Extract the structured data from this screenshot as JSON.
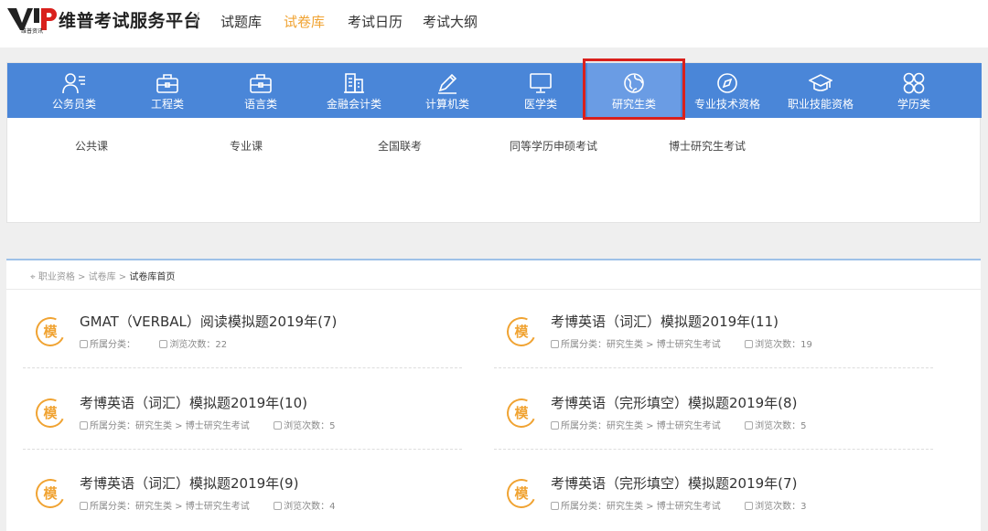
{
  "header": {
    "logo_text": "VIP",
    "logo_sub": "维普资讯",
    "brand": "维普考试服务平台",
    "slash": "/",
    "nav": [
      "试题库",
      "试卷库",
      "考试日历",
      "考试大纲"
    ],
    "active_nav": "试卷库",
    "colors": {
      "active": "#f0a332"
    }
  },
  "categories": {
    "items": [
      {
        "label": "公务员类",
        "icon": "person-list-icon"
      },
      {
        "label": "工程类",
        "icon": "briefcase-icon"
      },
      {
        "label": "语言类",
        "icon": "briefcase-icon"
      },
      {
        "label": "金融会计类",
        "icon": "building-icon"
      },
      {
        "label": "计算机类",
        "icon": "pencil-icon"
      },
      {
        "label": "医学类",
        "icon": "monitor-icon"
      },
      {
        "label": "研究生类",
        "icon": "globe-icon"
      },
      {
        "label": "专业技术资格",
        "icon": "compass-icon"
      },
      {
        "label": "职业技能资格",
        "icon": "graduation-cap-icon"
      },
      {
        "label": "学历类",
        "icon": "four-circles-icon"
      }
    ],
    "selected": "研究生类",
    "subcategories": [
      "公共课",
      "专业课",
      "全国联考",
      "同等学历申硕考试",
      "博士研究生考试"
    ],
    "colors": {
      "bar": "#4a86d8",
      "highlight": "#d9201c"
    }
  },
  "breadcrumb": {
    "items": [
      "职业资格",
      "试卷库",
      "试卷库首页"
    ],
    "separator": ">"
  },
  "papers": {
    "badge": "模",
    "category_label": "所属分类：",
    "views_label": "浏览次数：",
    "list": [
      {
        "title": "GMAT（VERBAL）阅读模拟题2019年(7)",
        "category": "",
        "views": "22"
      },
      {
        "title": "考博英语（词汇）模拟题2019年(11)",
        "category": "研究生类 > 博士研究生考试",
        "views": "19"
      },
      {
        "title": "考博英语（词汇）模拟题2019年(10)",
        "category": "研究生类 > 博士研究生考试",
        "views": "5"
      },
      {
        "title": "考博英语（完形填空）模拟题2019年(8)",
        "category": "研究生类 > 博士研究生考试",
        "views": "5"
      },
      {
        "title": "考博英语（词汇）模拟题2019年(9)",
        "category": "研究生类 > 博士研究生考试",
        "views": "4"
      },
      {
        "title": "考博英语（完形填空）模拟题2019年(7)",
        "category": "研究生类 > 博士研究生考试",
        "views": "3"
      }
    ]
  }
}
